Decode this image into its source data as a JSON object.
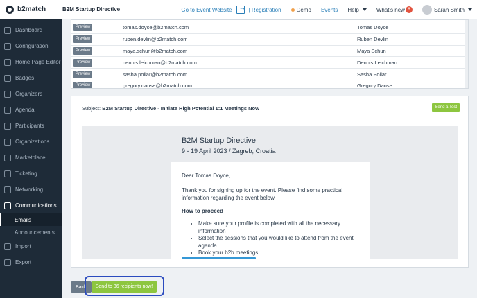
{
  "app": {
    "logo": "b2match",
    "event_name": "B2M Startup Directive"
  },
  "topnav": {
    "event_website": "Go to Event Website",
    "registration": "| Registration",
    "demo": "Demo",
    "events": "Events",
    "help": "Help",
    "whats_new": "What's new",
    "whats_new_count": "6",
    "user": "Sarah Smith"
  },
  "sidebar": {
    "items": [
      {
        "label": "Dashboard",
        "icon": "dashboard-icon"
      },
      {
        "label": "Configuration",
        "icon": "gear-icon"
      },
      {
        "label": "Home Page Editor",
        "icon": "pencil-icon"
      },
      {
        "label": "Badges",
        "icon": "badge-icon"
      },
      {
        "label": "Organizers",
        "icon": "people-icon"
      },
      {
        "label": "Agenda",
        "icon": "calendar-icon"
      },
      {
        "label": "Participants",
        "icon": "user-icon"
      },
      {
        "label": "Organizations",
        "icon": "building-icon"
      },
      {
        "label": "Marketplace",
        "icon": "store-icon"
      },
      {
        "label": "Ticketing",
        "icon": "ticket-icon"
      },
      {
        "label": "Networking",
        "icon": "network-icon"
      },
      {
        "label": "Communications",
        "icon": "chat-icon"
      }
    ],
    "subitems": [
      {
        "label": "Emails"
      },
      {
        "label": "Announcements"
      }
    ],
    "bottom": [
      {
        "label": "Import",
        "icon": "import-icon"
      },
      {
        "label": "Export",
        "icon": "export-icon"
      }
    ]
  },
  "recipients": {
    "preview_label": "Preview",
    "rows": [
      {
        "email": "tomas.doyce@b2match.com",
        "name": "Tomas Doyce"
      },
      {
        "email": "ruben.devlin@b2match.com",
        "name": "Ruben Devlin"
      },
      {
        "email": "maya.schun@b2match.com",
        "name": "Maya Schun"
      },
      {
        "email": "dennis.leichman@b2match.com",
        "name": "Dennis Leichman"
      },
      {
        "email": "sasha.pollar@b2match.com",
        "name": "Sasha Pollar"
      },
      {
        "email": "gregory.danse@b2match.com",
        "name": "Gregory Danse"
      }
    ]
  },
  "email": {
    "subject_label": "Subject:",
    "subject": "B2M Startup Directive - Initiate High Potential 1:1 Meetings Now",
    "send_test": "Send a Test",
    "event_title": "B2M Startup Directive",
    "event_date": "9 - 19 April 2023 / Zagreb, Croatia",
    "greeting": "Dear Tomas Doyce,",
    "intro": "Thank you for signing up for the event. Please find some practical information regarding the event below.",
    "heading": "How to proceed",
    "bullets": [
      "Make sure your profile is completed with all the necessary information",
      "Select the sessions that you would like to attend from the event agenda",
      "Book your b2b meetings."
    ]
  },
  "actions": {
    "back": "Back",
    "send": "Send to 36 recipients now!"
  }
}
